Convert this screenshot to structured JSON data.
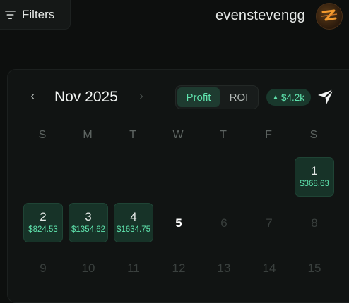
{
  "header": {
    "filters_label": "Filters",
    "username": "evenstevengg"
  },
  "calendar": {
    "month": "Nov 2025",
    "prev_icon": "‹",
    "next_icon": "›",
    "toggle": {
      "profit_label": "Profit",
      "roi_label": "ROI",
      "active": "Profit"
    },
    "total": "$4.2k",
    "weekdays": [
      "S",
      "M",
      "T",
      "W",
      "T",
      "F",
      "S"
    ],
    "days": [
      {
        "day": "1",
        "amount": "$368.63",
        "state": "profit"
      },
      {
        "day": "2",
        "amount": "$824.53",
        "state": "profit"
      },
      {
        "day": "3",
        "amount": "$1354.62",
        "state": "profit"
      },
      {
        "day": "4",
        "amount": "$1634.75",
        "state": "profit"
      },
      {
        "day": "5",
        "amount": "",
        "state": "today"
      },
      {
        "day": "6",
        "amount": "",
        "state": "future"
      },
      {
        "day": "7",
        "amount": "",
        "state": "future"
      },
      {
        "day": "8",
        "amount": "",
        "state": "future"
      },
      {
        "day": "9",
        "amount": "",
        "state": "future"
      },
      {
        "day": "10",
        "amount": "",
        "state": "future"
      },
      {
        "day": "11",
        "amount": "",
        "state": "future"
      },
      {
        "day": "12",
        "amount": "",
        "state": "future"
      },
      {
        "day": "13",
        "amount": "",
        "state": "future"
      },
      {
        "day": "14",
        "amount": "",
        "state": "future"
      },
      {
        "day": "15",
        "amount": "",
        "state": "future"
      }
    ]
  },
  "colors": {
    "accent": "#5fe3ad",
    "profit_cell_bg": "#173328",
    "background": "#0d0f0e"
  },
  "icons": {
    "filters": "filter-lines-icon",
    "share": "share-arrow-icon",
    "trend": "triangle-up-icon"
  }
}
